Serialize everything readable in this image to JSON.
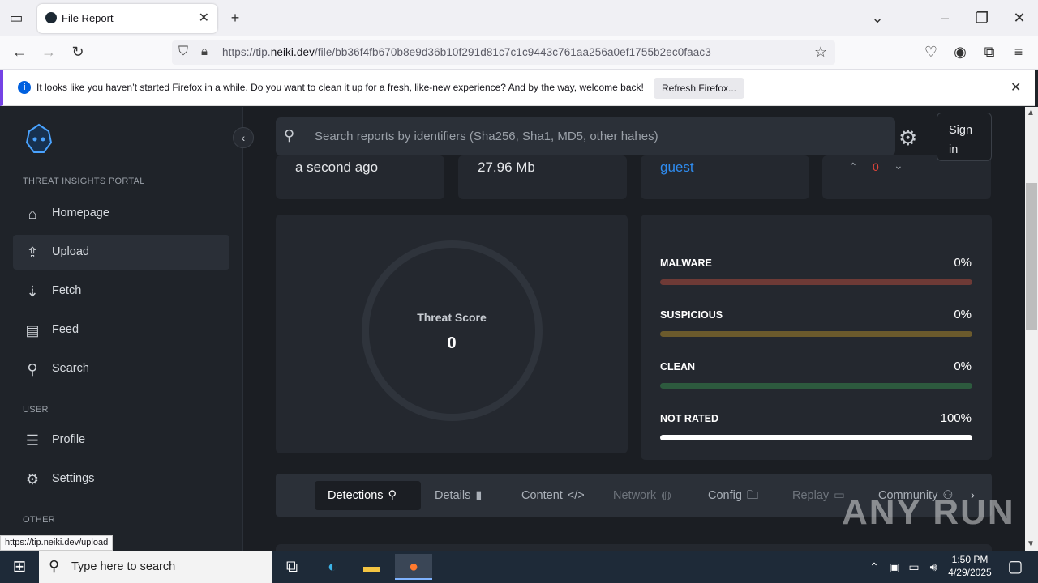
{
  "browser": {
    "tab_title": "File Report",
    "url_prefix": "https://tip.",
    "url_domain": "neiki.dev",
    "url_path": "/file/bb36f4fb670b8e9d36b10f291d81c7c1c9443c761aa256a0ef1755b2ec0faac3",
    "notification": "It looks like you haven’t started Firefox in a while. Do you want to clean it up for a fresh, like-new experience? And by the way, welcome back!",
    "refresh_button": "Refresh Firefox...",
    "status_url": "https://tip.neiki.dev/upload"
  },
  "sidebar": {
    "section_portal": "THREAT INSIGHTS PORTAL",
    "section_user": "USER",
    "section_other": "OTHER",
    "items": [
      {
        "label": "Homepage",
        "icon": "home-icon"
      },
      {
        "label": "Upload",
        "icon": "upload-icon"
      },
      {
        "label": "Fetch",
        "icon": "fetch-icon"
      },
      {
        "label": "Feed",
        "icon": "feed-icon"
      },
      {
        "label": "Search",
        "icon": "search-icon"
      },
      {
        "label": "Profile",
        "icon": "profile-icon"
      },
      {
        "label": "Settings",
        "icon": "gear-icon"
      }
    ]
  },
  "header": {
    "search_placeholder": "Search reports by identifiers (Sha256, Sha1, MD5, other hahes)",
    "signin_line1": "Sign",
    "signin_line2": "in"
  },
  "summary": {
    "time": "a second ago",
    "size": "27.96 Mb",
    "user": "guest",
    "votes": "0"
  },
  "threat": {
    "label": "Threat Score",
    "value": "0"
  },
  "stats": [
    {
      "label": "MALWARE",
      "pct": "0%",
      "color": "#6e3a36"
    },
    {
      "label": "SUSPICIOUS",
      "pct": "0%",
      "color": "#6b5a2c"
    },
    {
      "label": "CLEAN",
      "pct": "0%",
      "color": "#2d5a3e"
    },
    {
      "label": "NOT RATED",
      "pct": "100%",
      "color": "#ffffff"
    }
  ],
  "report_tabs": [
    "Detections",
    "Details",
    "Content",
    "Network",
    "Config",
    "Replay",
    "Community"
  ],
  "watermark": "ANY RUN",
  "taskbar": {
    "search_placeholder": "Type here to search",
    "time": "1:50 PM",
    "date": "4/29/2025"
  }
}
